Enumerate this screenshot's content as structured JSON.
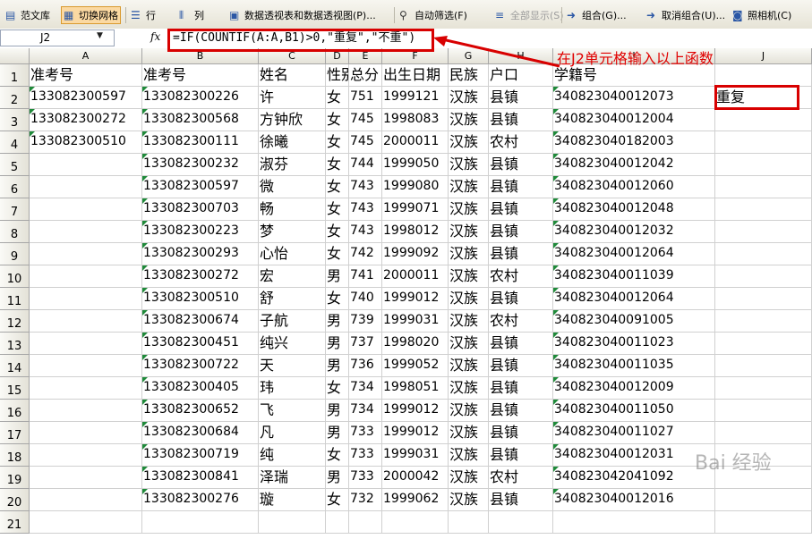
{
  "toolbar": {
    "items": [
      {
        "label": "范文库",
        "icon": "document-icon",
        "enabled": true
      },
      {
        "label": "切换网格",
        "icon": "grid-icon",
        "enabled": true,
        "pressed": true
      },
      {
        "label": "行",
        "icon": "insert-row-icon",
        "enabled": true
      },
      {
        "label": "列",
        "icon": "insert-column-icon",
        "enabled": true
      },
      {
        "label": "数据透视表和数据透视图(P)...",
        "icon": "pivot-table-icon",
        "enabled": true
      },
      {
        "label": "自动筛选(F)",
        "icon": "filter-icon",
        "enabled": true
      },
      {
        "label": "全部显示(S)",
        "icon": "show-all-icon",
        "enabled": false
      },
      {
        "label": "组合(G)...",
        "icon": "group-icon",
        "enabled": true
      },
      {
        "label": "取消组合(U)...",
        "icon": "ungroup-icon",
        "enabled": true
      },
      {
        "label": "照相机(C)",
        "icon": "camera-icon",
        "enabled": true
      }
    ]
  },
  "formula_bar": {
    "name_box": "J2",
    "fx_label": "fx",
    "formula": "=IF(COUNTIF(A:A,B1)>0,\"重复\",\"不重\")"
  },
  "grid": {
    "column_letters": [
      "A",
      "B",
      "C",
      "D",
      "E",
      "F",
      "G",
      "H",
      "I",
      "J"
    ],
    "row_numbers": [
      "1",
      "2",
      "3",
      "4",
      "5",
      "6",
      "7",
      "8",
      "9",
      "10",
      "11",
      "12",
      "13",
      "14",
      "15",
      "16",
      "17",
      "18",
      "19",
      "20",
      "21"
    ],
    "rows": [
      [
        "准考号",
        "准考号",
        "姓名",
        "性别",
        "总分",
        "出生日期",
        "民族",
        "户口",
        "学籍号",
        ""
      ],
      [
        "133082300597",
        "133082300226",
        "许",
        "女",
        "751",
        "1999121",
        "汉族",
        "县镇",
        "340823040012073",
        "重复"
      ],
      [
        "133082300272",
        "133082300568",
        "方钟欣",
        "女",
        "745",
        "1998083",
        "汉族",
        "县镇",
        "340823040012004",
        ""
      ],
      [
        "133082300510",
        "133082300111",
        "徐曦",
        "女",
        "745",
        "2000011",
        "汉族",
        "农村",
        "340823040182003",
        ""
      ],
      [
        "",
        "133082300232",
        "淑芬",
        "女",
        "744",
        "1999050",
        "汉族",
        "县镇",
        "340823040012042",
        ""
      ],
      [
        "",
        "133082300597",
        "微",
        "女",
        "743",
        "1999080",
        "汉族",
        "县镇",
        "340823040012060",
        ""
      ],
      [
        "",
        "133082300703",
        "畅",
        "女",
        "743",
        "1999071",
        "汉族",
        "县镇",
        "340823040012048",
        ""
      ],
      [
        "",
        "133082300223",
        "梦",
        "女",
        "743",
        "1998012",
        "汉族",
        "县镇",
        "340823040012032",
        ""
      ],
      [
        "",
        "133082300293",
        "心怡",
        "女",
        "742",
        "1999092",
        "汉族",
        "县镇",
        "340823040012064",
        ""
      ],
      [
        "",
        "133082300272",
        "宏",
        "男",
        "741",
        "2000011",
        "汉族",
        "农村",
        "340823040011039",
        ""
      ],
      [
        "",
        "133082300510",
        "舒",
        "女",
        "740",
        "1999012",
        "汉族",
        "县镇",
        "340823040012064",
        ""
      ],
      [
        "",
        "133082300674",
        "子航",
        "男",
        "739",
        "1999031",
        "汉族",
        "农村",
        "340823040091005",
        ""
      ],
      [
        "",
        "133082300451",
        "纯兴",
        "男",
        "737",
        "1998020",
        "汉族",
        "县镇",
        "340823040011023",
        ""
      ],
      [
        "",
        "133082300722",
        "天",
        "男",
        "736",
        "1999052",
        "汉族",
        "县镇",
        "340823040011035",
        ""
      ],
      [
        "",
        "133082300405",
        "玮",
        "女",
        "734",
        "1998051",
        "汉族",
        "县镇",
        "340823040012009",
        ""
      ],
      [
        "",
        "133082300652",
        "飞",
        "男",
        "734",
        "1999012",
        "汉族",
        "县镇",
        "340823040011050",
        ""
      ],
      [
        "",
        "133082300684",
        "凡",
        "男",
        "733",
        "1999012",
        "汉族",
        "县镇",
        "340823040011027",
        ""
      ],
      [
        "",
        "133082300719",
        "纯",
        "女",
        "733",
        "1999031",
        "汉族",
        "县镇",
        "340823040012031",
        ""
      ],
      [
        "",
        "133082300841",
        "泽瑞",
        "男",
        "733",
        "2000042",
        "汉族",
        "农村",
        "340823042041092",
        ""
      ],
      [
        "",
        "133082300276",
        "璇",
        "女",
        "732",
        "1999062",
        "汉族",
        "县镇",
        "340823040012016",
        ""
      ]
    ]
  },
  "annotation": {
    "text": "在J2单元格输入以上函数",
    "color": "#e00000"
  },
  "watermark": "Bai 经验",
  "colors": {
    "annotation_red": "#d80000",
    "error_indicator": "#1f8a3a",
    "toolbar_pressed": "#fbd9a2"
  }
}
